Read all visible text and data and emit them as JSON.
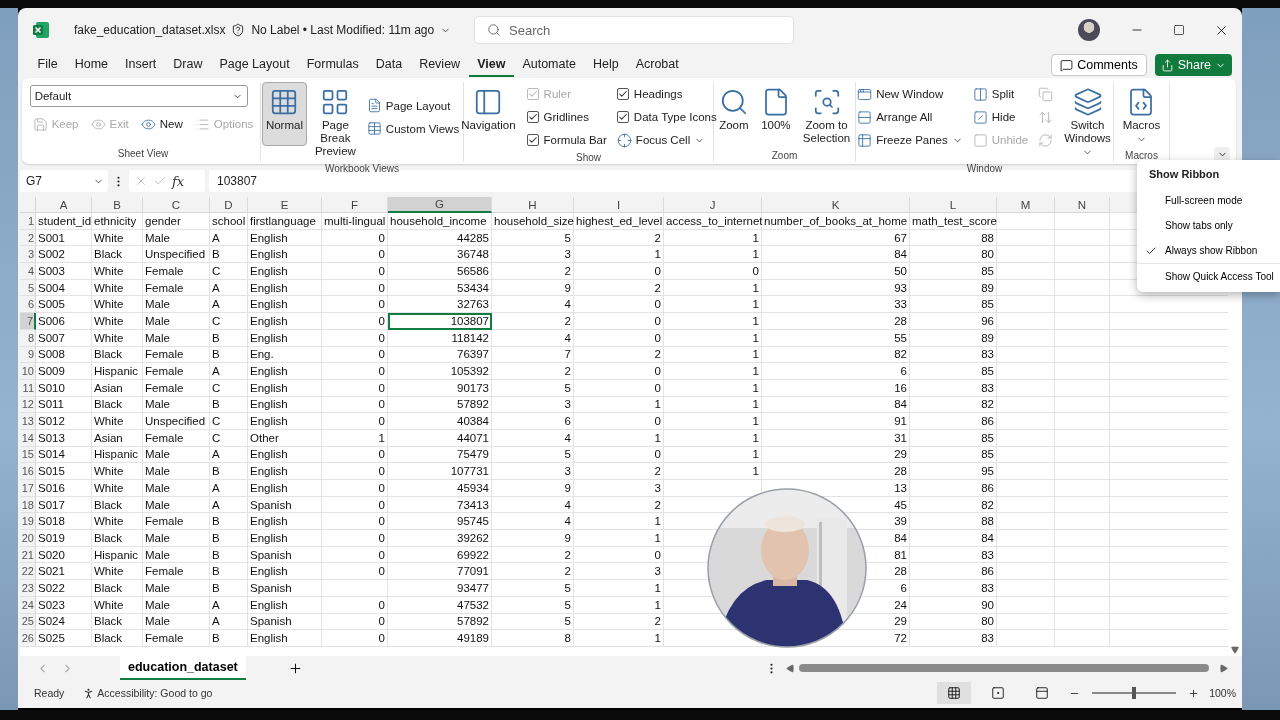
{
  "title_bar": {
    "file_name": "fake_education_dataset.xlsx",
    "status": "No Label • Last Modified: 11m ago",
    "search_placeholder": "Search"
  },
  "menu_tabs": [
    {
      "label": "File",
      "selected": false
    },
    {
      "label": "Home",
      "selected": false
    },
    {
      "label": "Insert",
      "selected": false
    },
    {
      "label": "Draw",
      "selected": false
    },
    {
      "label": "Page Layout",
      "selected": false
    },
    {
      "label": "Formulas",
      "selected": false
    },
    {
      "label": "Data",
      "selected": false
    },
    {
      "label": "Review",
      "selected": false
    },
    {
      "label": "View",
      "selected": true
    },
    {
      "label": "Automate",
      "selected": false
    },
    {
      "label": "Help",
      "selected": false
    },
    {
      "label": "Acrobat",
      "selected": false
    }
  ],
  "header_buttons": {
    "comments": "Comments",
    "share": "Share"
  },
  "ribbon": {
    "groups": [
      {
        "label": "Sheet View",
        "kind": "stack",
        "items": [
          {
            "kind": "select",
            "value": "Default",
            "disabled": false
          },
          {
            "kind": "small",
            "label": "Keep",
            "disabled": true
          },
          {
            "kind": "small",
            "label": "Exit",
            "disabled": true
          },
          {
            "kind": "small",
            "label": "New",
            "disabled": false
          },
          {
            "kind": "small",
            "label": "Options",
            "disabled": true
          }
        ]
      },
      {
        "label": "Workbook Views",
        "kind": "columns",
        "items": [
          {
            "kind": "large",
            "label": "Normal",
            "selected": true,
            "disabled": false
          },
          {
            "kind": "large",
            "label": "Page Break Preview",
            "selected": false,
            "disabled": false
          },
          {
            "kind": "small",
            "label": "Page Layout",
            "disabled": false
          },
          {
            "kind": "small",
            "label": "Custom Views",
            "disabled": false
          }
        ]
      },
      {
        "label": "Show",
        "kind": "columns",
        "items": [
          {
            "kind": "large",
            "label": "Navigation",
            "disabled": false
          },
          {
            "kind": "check",
            "label": "Ruler",
            "checked": true,
            "disabled": true
          },
          {
            "kind": "check",
            "label": "Gridlines",
            "checked": true,
            "disabled": false
          },
          {
            "kind": "check",
            "label": "Formula Bar",
            "checked": true,
            "disabled": false
          },
          {
            "kind": "check",
            "label": "Headings",
            "checked": true,
            "disabled": false
          },
          {
            "kind": "check",
            "label": "Data Type Icons",
            "checked": true,
            "disabled": false
          },
          {
            "kind": "small",
            "label": "Focus Cell",
            "disabled": false,
            "dropdown": true
          }
        ]
      },
      {
        "label": "Zoom",
        "kind": "columns",
        "items": [
          {
            "kind": "large",
            "label": "Zoom",
            "disabled": false
          },
          {
            "kind": "large",
            "label": "100%",
            "disabled": false
          },
          {
            "kind": "large",
            "label": "Zoom to Selection",
            "disabled": false
          }
        ]
      },
      {
        "label": "Window",
        "kind": "columns",
        "items": [
          {
            "kind": "small",
            "label": "New Window",
            "disabled": false
          },
          {
            "kind": "small",
            "label": "Arrange All",
            "disabled": false
          },
          {
            "kind": "small",
            "label": "Freeze Panes",
            "disabled": false,
            "dropdown": true
          },
          {
            "kind": "small",
            "label": "Split",
            "disabled": false
          },
          {
            "kind": "small",
            "label": "Hide",
            "disabled": false
          },
          {
            "kind": "small",
            "label": "Unhide",
            "disabled": true
          },
          {
            "kind": "icon",
            "disabled": true
          },
          {
            "kind": "icon",
            "disabled": true
          },
          {
            "kind": "icon",
            "disabled": true
          },
          {
            "kind": "large",
            "label": "Switch Windows",
            "disabled": false,
            "dropdown": true
          }
        ]
      },
      {
        "label": "Macros",
        "kind": "columns",
        "items": [
          {
            "kind": "large",
            "label": "Macros",
            "disabled": false,
            "dropdown": true
          }
        ]
      }
    ]
  },
  "formula_bar": {
    "name_box": "G7",
    "function_label": "fx",
    "formula": "103807"
  },
  "sheet": {
    "columns": [
      {
        "letter": "A",
        "kind": "text",
        "selected": false
      },
      {
        "letter": "B",
        "kind": "text",
        "selected": false
      },
      {
        "letter": "C",
        "kind": "text",
        "selected": false
      },
      {
        "letter": "D",
        "kind": "text",
        "selected": false
      },
      {
        "letter": "E",
        "kind": "text",
        "selected": false
      },
      {
        "letter": "F",
        "kind": "number",
        "selected": false
      },
      {
        "letter": "G",
        "kind": "number",
        "selected": true
      },
      {
        "letter": "H",
        "kind": "number",
        "selected": false
      },
      {
        "letter": "I",
        "kind": "number",
        "selected": false
      },
      {
        "letter": "J",
        "kind": "number",
        "selected": false
      },
      {
        "letter": "K",
        "kind": "number",
        "selected": false
      },
      {
        "letter": "L",
        "kind": "number",
        "selected": false
      },
      {
        "letter": "M",
        "kind": "text",
        "selected": false
      },
      {
        "letter": "N",
        "kind": "text",
        "selected": false
      }
    ],
    "rows": [
      {
        "number": "1",
        "kind": "labels",
        "selected": false,
        "cells": [
          "student_id",
          "ethnicity",
          "gender",
          "school",
          "firstlanguage",
          "multi-lingual",
          "household_income",
          "household_size",
          "highest_ed_level",
          "access_to_internet",
          "number_of_books_at_home",
          "math_test_score"
        ]
      },
      {
        "number": "2",
        "kind": "records",
        "selected": false,
        "cells": [
          "S001",
          "White",
          "Male",
          "A",
          "English",
          "0",
          "44285",
          "5",
          "2",
          "1",
          "67",
          "88"
        ]
      },
      {
        "number": "3",
        "kind": "records",
        "selected": false,
        "cells": [
          "S002",
          "Black",
          "Unspecified",
          "B",
          "English",
          "0",
          "36748",
          "3",
          "1",
          "1",
          "84",
          "80"
        ]
      },
      {
        "number": "4",
        "kind": "records",
        "selected": false,
        "cells": [
          "S003",
          "White",
          "Female",
          "C",
          "English",
          "0",
          "56586",
          "2",
          "0",
          "0",
          "50",
          "85"
        ]
      },
      {
        "number": "5",
        "kind": "records",
        "selected": false,
        "cells": [
          "S004",
          "White",
          "Female",
          "A",
          "English",
          "0",
          "53434",
          "9",
          "2",
          "1",
          "93",
          "89"
        ]
      },
      {
        "number": "6",
        "kind": "records",
        "selected": false,
        "cells": [
          "S005",
          "White",
          "Male",
          "A",
          "English",
          "0",
          "32763",
          "4",
          "0",
          "1",
          "33",
          "85"
        ]
      },
      {
        "number": "7",
        "kind": "records",
        "selected": true,
        "cells": [
          "S006",
          "White",
          "Male",
          "C",
          "English",
          "0",
          "103807",
          "2",
          "0",
          "1",
          "28",
          "96"
        ]
      },
      {
        "number": "8",
        "kind": "records",
        "selected": false,
        "cells": [
          "S007",
          "White",
          "Male",
          "B",
          "English",
          "0",
          "118142",
          "4",
          "0",
          "1",
          "55",
          "89"
        ]
      },
      {
        "number": "9",
        "kind": "records",
        "selected": false,
        "cells": [
          "S008",
          "Black",
          "Female",
          "B",
          "Eng.",
          "0",
          "76397",
          "7",
          "2",
          "1",
          "82",
          "83"
        ]
      },
      {
        "number": "10",
        "kind": "records",
        "selected": false,
        "cells": [
          "S009",
          "Hispanic",
          "Female",
          "A",
          "English",
          "0",
          "105392",
          "2",
          "0",
          "1",
          "6",
          "85"
        ]
      },
      {
        "number": "11",
        "kind": "records",
        "selected": false,
        "cells": [
          "S010",
          "Asian",
          "Female",
          "C",
          "English",
          "0",
          "90173",
          "5",
          "0",
          "1",
          "16",
          "83"
        ]
      },
      {
        "number": "12",
        "kind": "records",
        "selected": false,
        "cells": [
          "S011",
          "Black",
          "Male",
          "B",
          "English",
          "0",
          "57892",
          "3",
          "1",
          "1",
          "84",
          "82"
        ]
      },
      {
        "number": "13",
        "kind": "records",
        "selected": false,
        "cells": [
          "S012",
          "White",
          "Unspecified",
          "C",
          "English",
          "0",
          "40384",
          "6",
          "0",
          "1",
          "91",
          "86"
        ]
      },
      {
        "number": "14",
        "kind": "records",
        "selected": false,
        "cells": [
          "S013",
          "Asian",
          "Female",
          "C",
          "Other",
          "1",
          "44071",
          "4",
          "1",
          "1",
          "31",
          "85"
        ]
      },
      {
        "number": "15",
        "kind": "records",
        "selected": false,
        "cells": [
          "S014",
          "Hispanic",
          "Male",
          "A",
          "English",
          "0",
          "75479",
          "5",
          "0",
          "1",
          "29",
          "85"
        ]
      },
      {
        "number": "16",
        "kind": "records",
        "selected": false,
        "cells": [
          "S015",
          "White",
          "Male",
          "B",
          "English",
          "0",
          "107731",
          "3",
          "2",
          "1",
          "28",
          "95"
        ]
      },
      {
        "number": "17",
        "kind": "records",
        "selected": false,
        "cells": [
          "S016",
          "White",
          "Male",
          "A",
          "English",
          "0",
          "45934",
          "9",
          "3",
          null,
          "13",
          "86"
        ]
      },
      {
        "number": "18",
        "kind": "records",
        "selected": false,
        "cells": [
          "S017",
          "Black",
          "Male",
          "A",
          "Spanish",
          "0",
          "73413",
          "4",
          "2",
          null,
          "45",
          "82"
        ]
      },
      {
        "number": "19",
        "kind": "records",
        "selected": false,
        "cells": [
          "S018",
          "White",
          "Female",
          "B",
          "English",
          "0",
          "95745",
          "4",
          "1",
          null,
          "39",
          "88"
        ]
      },
      {
        "number": "20",
        "kind": "records",
        "selected": false,
        "cells": [
          "S019",
          "Black",
          "Male",
          "B",
          "English",
          "0",
          "39262",
          "9",
          "1",
          null,
          "84",
          "84"
        ]
      },
      {
        "number": "21",
        "kind": "records",
        "selected": false,
        "cells": [
          "S020",
          "Hispanic",
          "Male",
          "B",
          "Spanish",
          "0",
          "69922",
          "2",
          "0",
          null,
          "81",
          "83"
        ]
      },
      {
        "number": "22",
        "kind": "records",
        "selected": false,
        "cells": [
          "S021",
          "White",
          "Female",
          "B",
          "English",
          "0",
          "77091",
          "2",
          "3",
          null,
          "28",
          "86"
        ]
      },
      {
        "number": "23",
        "kind": "records",
        "selected": false,
        "cells": [
          "S022",
          "Black",
          "Male",
          "B",
          "Spanish",
          null,
          "93477",
          "5",
          "1",
          null,
          "6",
          "83"
        ]
      },
      {
        "number": "24",
        "kind": "records",
        "selected": false,
        "cells": [
          "S023",
          "White",
          "Male",
          "A",
          "English",
          "0",
          "47532",
          "5",
          "1",
          null,
          "24",
          "90"
        ]
      },
      {
        "number": "25",
        "kind": "records",
        "selected": false,
        "cells": [
          "S024",
          "Black",
          "Male",
          "A",
          "Spanish",
          "0",
          "57892",
          "5",
          "2",
          null,
          "29",
          "80"
        ]
      },
      {
        "number": "26",
        "kind": "records",
        "selected": false,
        "cells": [
          "S025",
          "Black",
          "Female",
          "B",
          "English",
          "0",
          "49189",
          "8",
          "1",
          null,
          "72",
          "83"
        ]
      }
    ]
  },
  "sheet_tabs": [
    {
      "name": "education_dataset",
      "selected": true
    }
  ],
  "status_bar": {
    "mode": "Ready",
    "accessibility": "Accessibility: Good to go",
    "views": [
      {
        "selected": true
      },
      {
        "selected": false
      },
      {
        "selected": false
      }
    ],
    "zoom": {
      "level": 0.5,
      "reading": "100%"
    }
  },
  "ribbon_menu": {
    "title": "Show Ribbon",
    "items": [
      {
        "label": "Full-screen mode",
        "checked": false
      },
      {
        "label": "Show tabs only",
        "checked": false
      },
      {
        "label": "Always show Ribbon",
        "checked": true
      },
      {
        "label": "Show Quick Access Tool",
        "checked": false
      }
    ]
  }
}
